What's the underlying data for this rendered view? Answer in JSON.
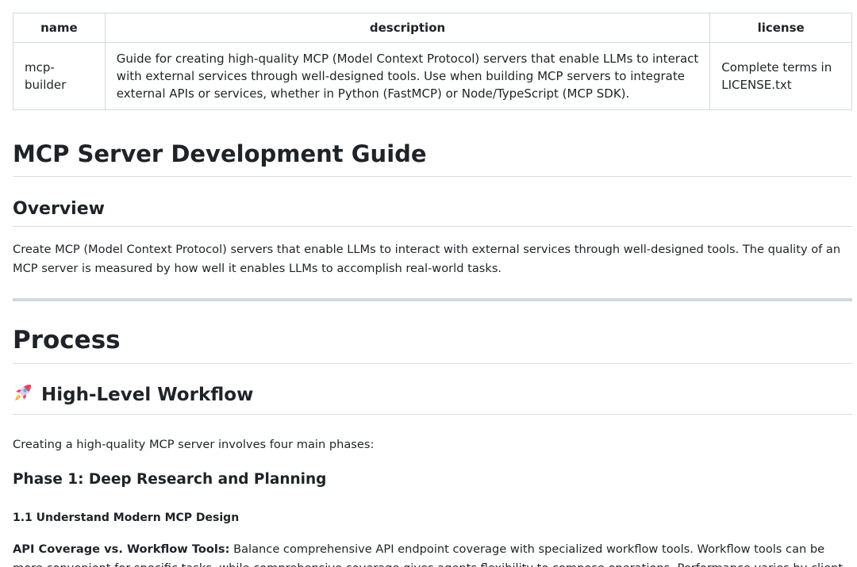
{
  "table": {
    "headers": [
      "name",
      "description",
      "license"
    ],
    "rows": [
      {
        "name": "mcp-builder",
        "description": "Guide for creating high-quality MCP (Model Context Protocol) servers that enable LLMs to interact with external services through well-designed tools. Use when building MCP servers to integrate external APIs or services, whether in Python (FastMCP) or Node/TypeScript (MCP SDK).",
        "license": "Complete terms in LICENSE.txt"
      }
    ]
  },
  "title": "MCP Server Development Guide",
  "overview": {
    "heading": "Overview",
    "text": "Create MCP (Model Context Protocol) servers that enable LLMs to interact with external services through well-designed tools. The quality of an MCP server is measured by how well it enables LLMs to accomplish real-world tasks."
  },
  "process": {
    "heading": "Process",
    "workflow_heading": "High-Level Workflow",
    "workflow_icon": "rocket-icon",
    "workflow_intro": "Creating a high-quality MCP server involves four main phases:",
    "phase1_heading": "Phase 1: Deep Research and Planning",
    "sub1_heading": "1.1 Understand Modern MCP Design",
    "api_label": "API Coverage vs. Workflow Tools:",
    "api_text": " Balance comprehensive API endpoint coverage with specialized workflow tools. Workflow tools can be more convenient for specific tasks, while comprehensive coverage gives agents flexibility to compose operations. Performance varies by client"
  },
  "colors": {
    "text": "#1f2328",
    "border": "#d1d9e0",
    "rule": "#d8dee4"
  }
}
